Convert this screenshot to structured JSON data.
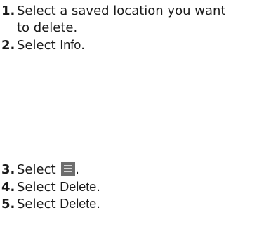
{
  "steps": [
    {
      "num": "1.",
      "text": "Select a saved location you want",
      "text_cont": "to delete."
    },
    {
      "num": "2.",
      "pre": "Select ",
      "keyword": "Info",
      "post": "."
    },
    {
      "num": "3.",
      "pre": "Select ",
      "icon": "menu-icon",
      "post": "."
    },
    {
      "num": "4.",
      "pre": "Select ",
      "keyword": "Delete",
      "post": "."
    },
    {
      "num": "5.",
      "pre": "Select ",
      "keyword": "Delete",
      "post": "."
    }
  ]
}
